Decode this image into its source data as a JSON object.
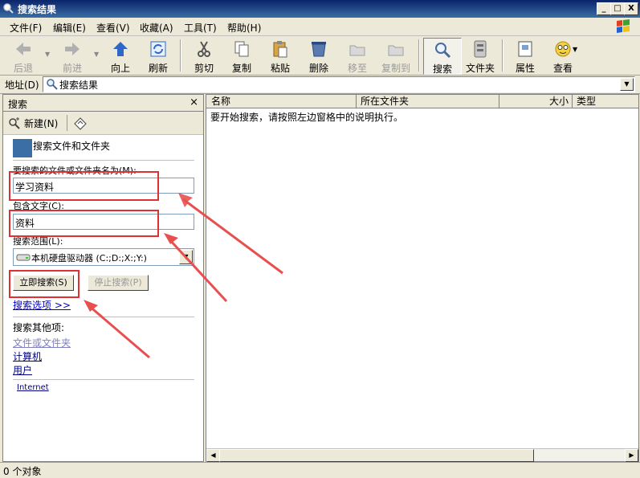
{
  "window": {
    "title": "搜索结果",
    "controls": [
      "_",
      "□",
      "X"
    ]
  },
  "menu": [
    "文件(F)",
    "编辑(E)",
    "查看(V)",
    "收藏(A)",
    "工具(T)",
    "帮助(H)"
  ],
  "toolbar": {
    "back": "后退",
    "forward": "前进",
    "up": "向上",
    "refresh": "刷新",
    "cut": "剪切",
    "copy": "复制",
    "paste": "粘贴",
    "delete": "删除",
    "move_to": "移至",
    "copy_to": "复制到",
    "search": "搜索",
    "folders": "文件夹",
    "properties": "属性",
    "view": "查看"
  },
  "address": {
    "label": "地址(D)",
    "value": "搜索结果"
  },
  "search_pane": {
    "title": "搜索",
    "close": "×",
    "new_label": "新建(N)",
    "header": "搜索文件和文件夹",
    "name_label": "要搜索的文件或文件夹名为(M):",
    "name_value": "学习资料",
    "text_label": "包含文字(C):",
    "text_value": "资料",
    "scope_label": "搜索范围(L):",
    "scope_value": "本机硬盘驱动器 (C:;D:;X:;Y:)",
    "search_now": "立即搜索(S)",
    "stop_search": "停止搜索(P)",
    "options": "搜索选项 >>",
    "other_label": "搜索其他项:",
    "other_items": [
      "文件或文件夹",
      "计算机",
      "用户"
    ],
    "internet": "Internet"
  },
  "results": {
    "columns": [
      "名称",
      "所在文件夹",
      "大小",
      "类型"
    ],
    "message": "要开始搜索，请按照左边窗格中的说明执行。"
  },
  "status": {
    "text": "0 个对象"
  },
  "colors": {
    "title_start": "#0A246A",
    "title_end": "#3A6EA5",
    "annotation": "#e03030"
  }
}
